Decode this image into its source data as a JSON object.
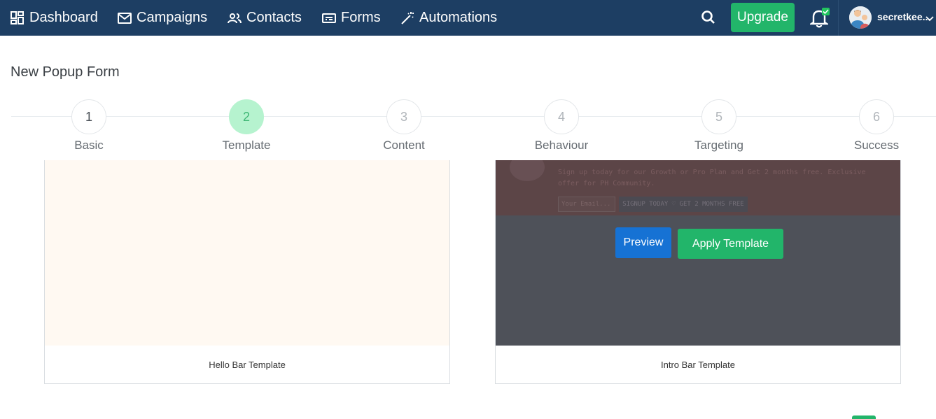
{
  "nav": {
    "items": [
      {
        "label": "Dashboard",
        "icon": "dashboard-icon"
      },
      {
        "label": "Campaigns",
        "icon": "mail-icon"
      },
      {
        "label": "Contacts",
        "icon": "contacts-icon"
      },
      {
        "label": "Forms",
        "icon": "forms-icon"
      },
      {
        "label": "Automations",
        "icon": "magic-wand-icon"
      }
    ],
    "upgrade_label": "Upgrade",
    "user_name": "secretkee...",
    "colors": {
      "bar": "#1d3e63",
      "accent": "#22b56a"
    }
  },
  "page": {
    "title": "New Popup Form"
  },
  "stepper": {
    "steps": [
      {
        "number": "1",
        "label": "Basic",
        "state": "done"
      },
      {
        "number": "2",
        "label": "Template",
        "state": "active"
      },
      {
        "number": "3",
        "label": "Content",
        "state": "pending"
      },
      {
        "number": "4",
        "label": "Behaviour",
        "state": "pending"
      },
      {
        "number": "5",
        "label": "Targeting",
        "state": "pending"
      },
      {
        "number": "6",
        "label": "Success",
        "state": "pending"
      }
    ]
  },
  "templates": [
    {
      "name": "Hello Bar Template"
    },
    {
      "name": "Intro Bar Template",
      "preview_text": "Sign up today for our Growth or Pro Plan and Get 2 months free. Exclusive offer for PH Community.",
      "preview_input_placeholder": "Your Email...",
      "preview_cta": "SIGNUP TODAY ♡ GET 2 MONTHS FREE",
      "preview_button": "Preview",
      "apply_button": "Apply Template"
    }
  ]
}
